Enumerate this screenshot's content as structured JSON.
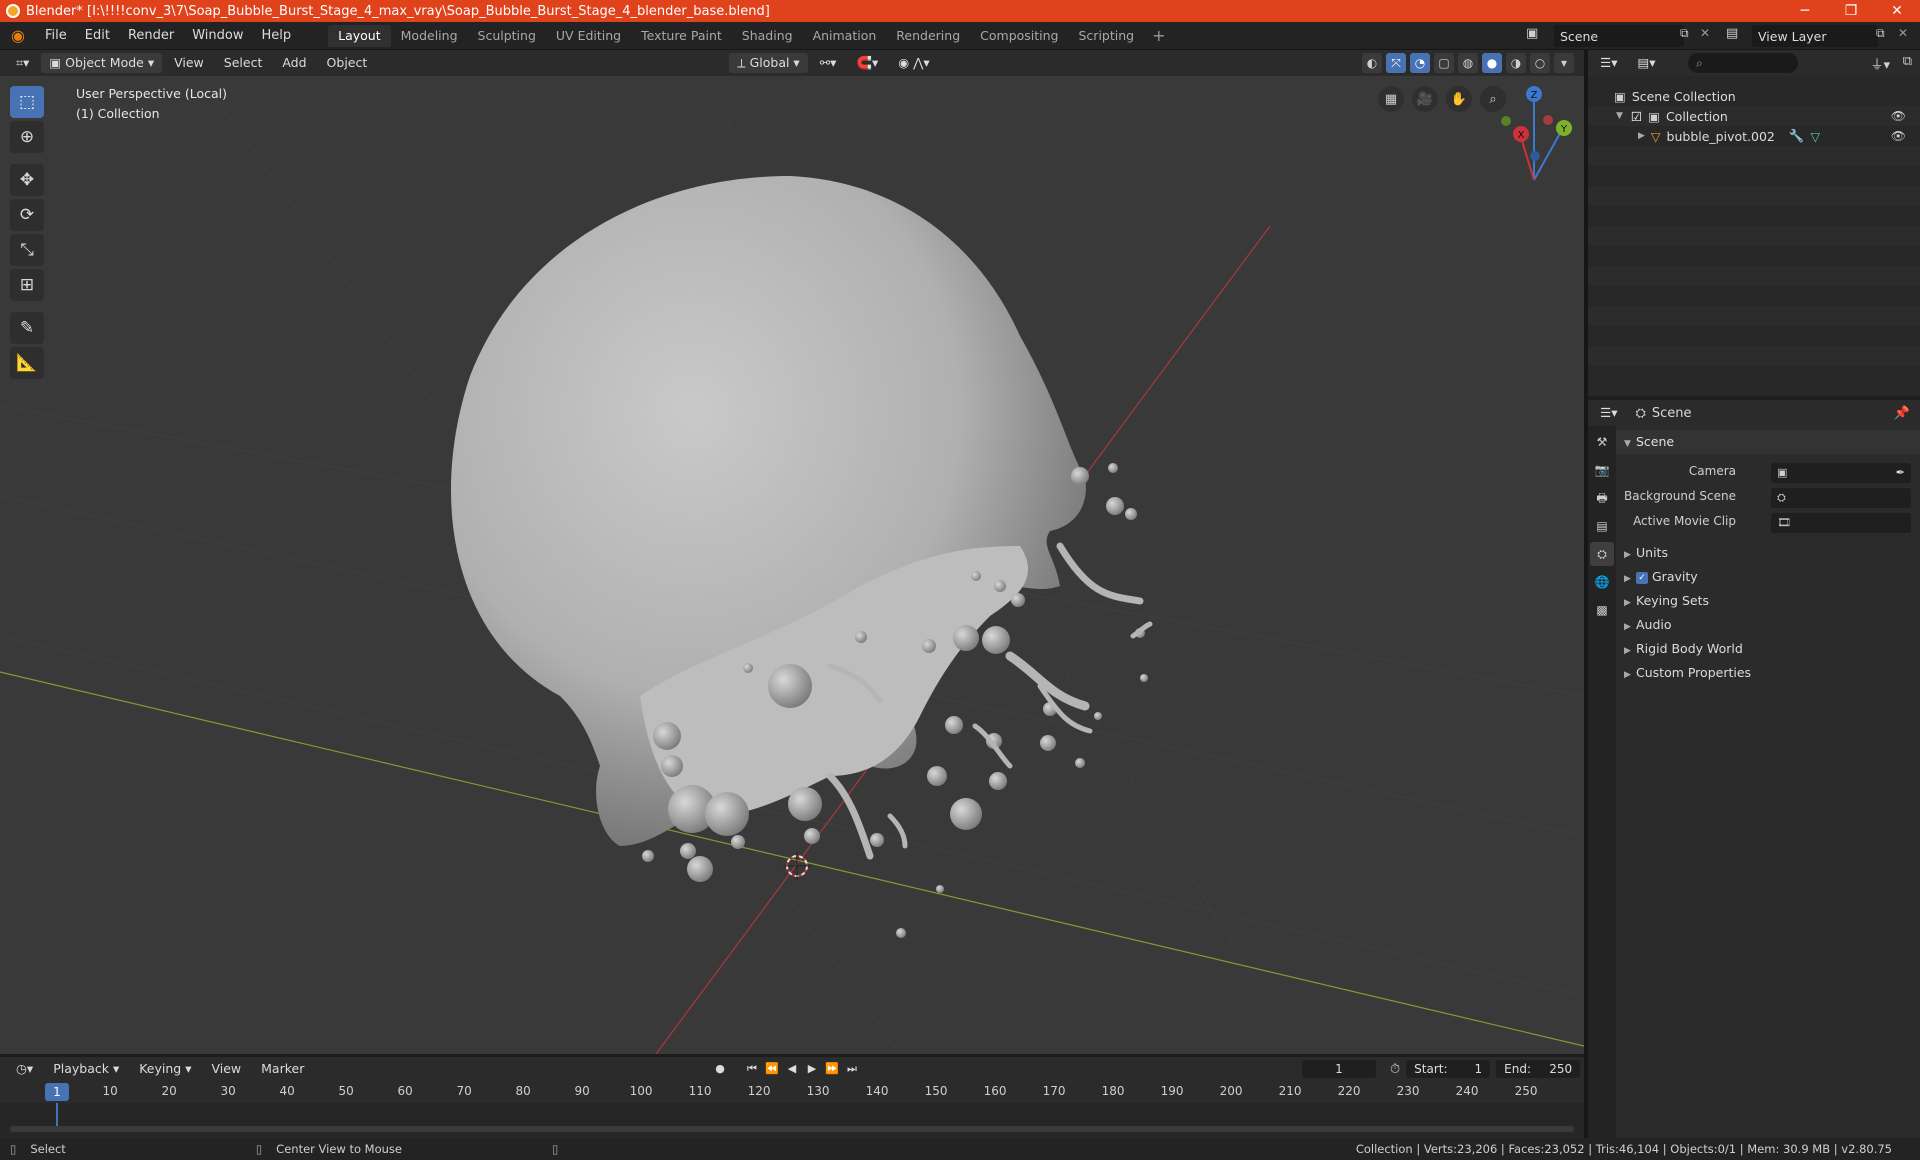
{
  "window": {
    "title": "Blender* [I:\\!!!!conv_3\\7\\Soap_Bubble_Burst_Stage_4_max_vray\\Soap_Bubble_Burst_Stage_4_blender_base.blend]",
    "minimize": "─",
    "maximize": "❐",
    "close": "✕"
  },
  "menu": [
    "File",
    "Edit",
    "Render",
    "Window",
    "Help"
  ],
  "workspaces": [
    "Layout",
    "Modeling",
    "Sculpting",
    "UV Editing",
    "Texture Paint",
    "Shading",
    "Animation",
    "Rendering",
    "Compositing",
    "Scripting"
  ],
  "workspace_add": "+",
  "scene_name": "Scene",
  "view_layer": "View Layer",
  "viewport_header": {
    "mode": "Object Mode",
    "view": "View",
    "select": "Select",
    "add": "Add",
    "object": "Object",
    "orientation": "Global"
  },
  "viewport": {
    "perspective": "User Perspective (Local)",
    "collection": "(1) Collection",
    "axis_x": "X",
    "axis_y": "Y",
    "axis_z": "Z"
  },
  "outliner": {
    "search_placeholder": "",
    "scene_collection": "Scene Collection",
    "collection": "Collection",
    "object": "bubble_pivot.002"
  },
  "properties": {
    "header": "Scene",
    "panel_scene": "Scene",
    "camera_label": "Camera",
    "background_scene_label": "Background Scene",
    "active_movie_clip_label": "Active Movie Clip",
    "subpanels": [
      "Units",
      "Gravity",
      "Keying Sets",
      "Audio",
      "Rigid Body World",
      "Custom Properties"
    ]
  },
  "timeline": {
    "playback": "Playback",
    "keying": "Keying",
    "view": "View",
    "marker": "Marker",
    "current_frame": "1",
    "start_label": "Start:",
    "start": "1",
    "end_label": "End:",
    "end": "250",
    "ticks": [
      "10",
      "20",
      "30",
      "40",
      "50",
      "60",
      "70",
      "80",
      "90",
      "100",
      "110",
      "120",
      "130",
      "140",
      "150",
      "160",
      "170",
      "180",
      "190",
      "200",
      "210",
      "220",
      "230",
      "240",
      "250"
    ],
    "marker_frame": "1"
  },
  "status": {
    "select": "Select",
    "center_view": "Center View to Mouse",
    "info": "Collection | Verts:23,206 | Faces:23,052 | Tris:46,104 | Objects:0/1 | Mem: 30.9 MB | v2.80.75"
  }
}
